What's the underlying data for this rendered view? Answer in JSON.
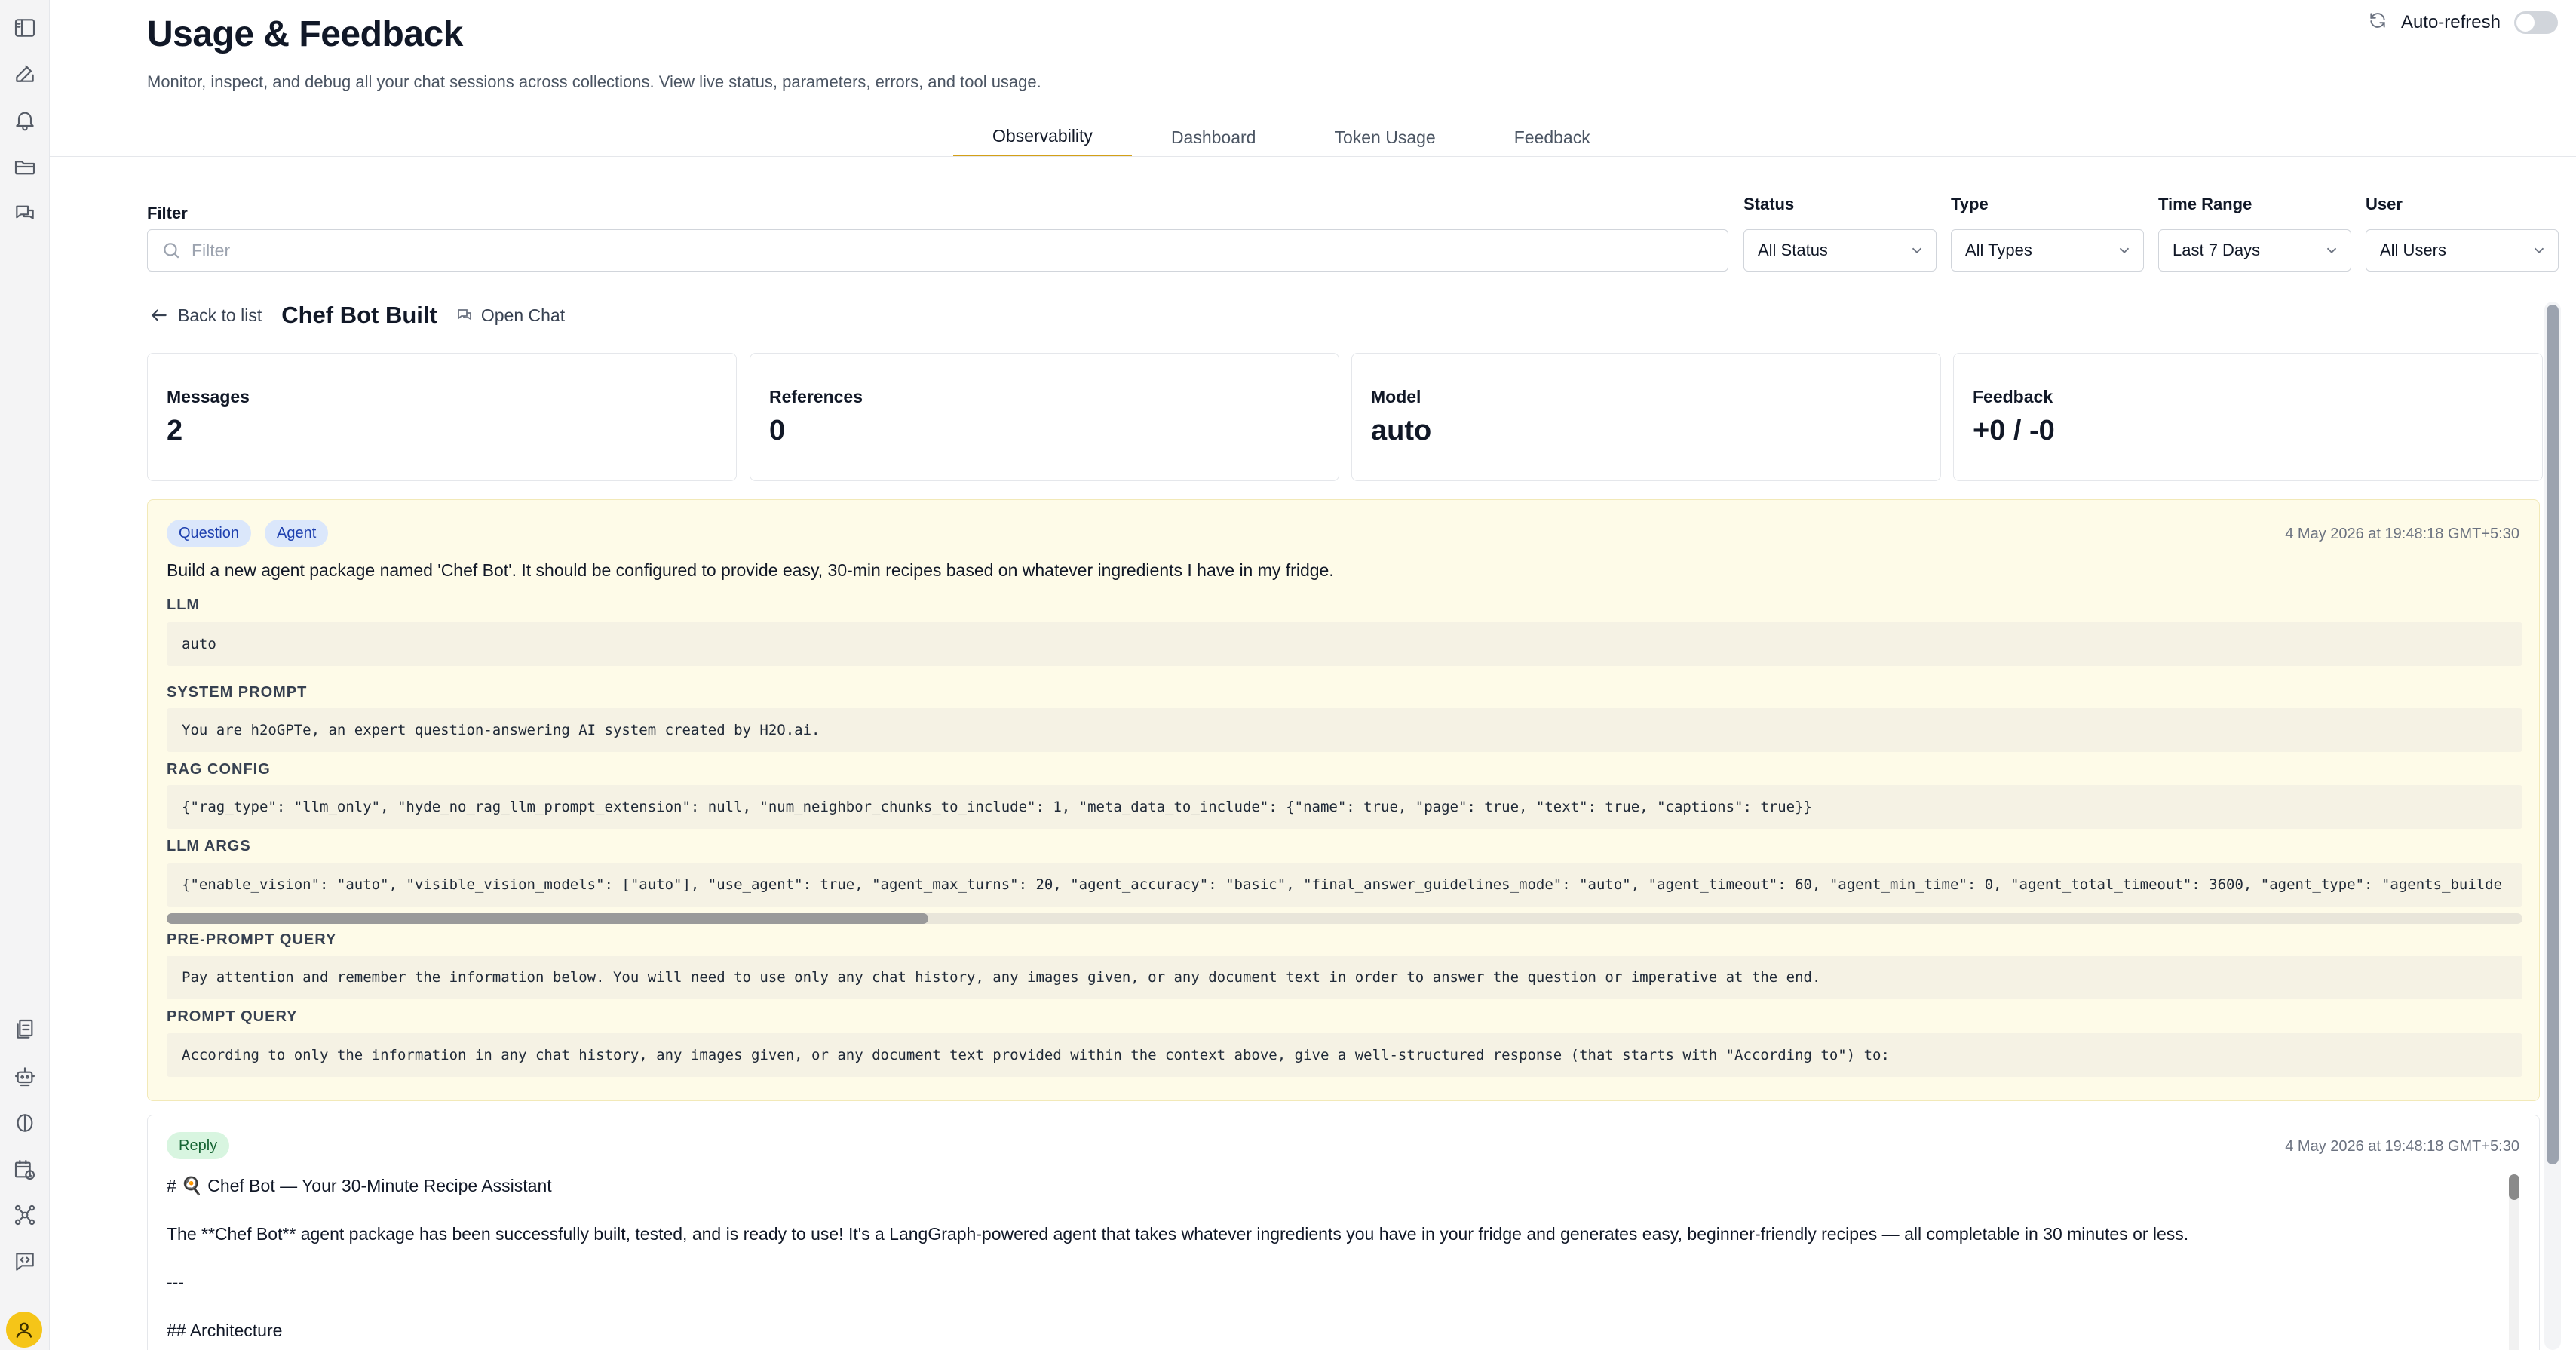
{
  "header": {
    "title": "Usage & Feedback",
    "subtitle": "Monitor, inspect, and debug all your chat sessions across collections. View live status, parameters, errors, and tool usage.",
    "auto_refresh_label": "Auto-refresh",
    "auto_refresh_on": false
  },
  "tabs": [
    {
      "label": "Observability",
      "active": true
    },
    {
      "label": "Dashboard",
      "active": false
    },
    {
      "label": "Token Usage",
      "active": false
    },
    {
      "label": "Feedback",
      "active": false
    }
  ],
  "filters": {
    "filter_label": "Filter",
    "filter_placeholder": "Filter",
    "status": {
      "label": "Status",
      "value": "All Status"
    },
    "type": {
      "label": "Type",
      "value": "All Types"
    },
    "time_range": {
      "label": "Time Range",
      "value": "Last 7 Days"
    },
    "user": {
      "label": "User",
      "value": "All Users"
    }
  },
  "detail": {
    "back_label": "Back to list",
    "chat_name": "Chef Bot Built",
    "open_chat_label": "Open Chat"
  },
  "stats": [
    {
      "label": "Messages",
      "value": "2"
    },
    {
      "label": "References",
      "value": "0"
    },
    {
      "label": "Model",
      "value": "auto"
    },
    {
      "label": "Feedback",
      "value": "+0 / -0"
    }
  ],
  "question": {
    "badges": [
      "Question",
      "Agent"
    ],
    "timestamp": "4 May 2026 at 19:48:18 GMT+5:30",
    "text": "Build a new agent package named 'Chef Bot'. It should be configured to provide easy, 30-min recipes based on whatever ingredients I have in my fridge.",
    "sections": [
      {
        "label": "LLM",
        "value": "auto"
      },
      {
        "label": "SYSTEM PROMPT",
        "value": "You are h2oGPTe, an expert question-answering AI system created by H2O.ai."
      },
      {
        "label": "RAG CONFIG",
        "value": "{\"rag_type\": \"llm_only\", \"hyde_no_rag_llm_prompt_extension\": null, \"num_neighbor_chunks_to_include\": 1, \"meta_data_to_include\": {\"name\": true, \"page\": true, \"text\": true, \"captions\": true}}"
      },
      {
        "label": "LLM ARGS",
        "value": "{\"enable_vision\": \"auto\", \"visible_vision_models\": [\"auto\"], \"use_agent\": true, \"agent_max_turns\": 20, \"agent_accuracy\": \"basic\", \"final_answer_guidelines_mode\": \"auto\", \"agent_timeout\": 60, \"agent_min_time\": 0, \"agent_total_timeout\": 3600, \"agent_type\": \"agents_builde"
      },
      {
        "label": "PRE-PROMPT QUERY",
        "value": "Pay attention and remember the information below. You will need to use only any chat history, any images given, or any document text in order to answer the question or imperative at the end."
      },
      {
        "label": "PROMPT QUERY",
        "value": "According to only the information in any chat history, any images given, or any document text provided within the context above, give a well-structured response (that starts with \"According to\") to:"
      }
    ]
  },
  "reply": {
    "badge": "Reply",
    "timestamp": "4 May 2026 at 19:48:18 GMT+5:30",
    "lines": [
      "# 🍳 Chef Bot — Your 30-Minute Recipe Assistant",
      "The **Chef Bot** agent package has been successfully built, tested, and is ready to use! It's a LangGraph-powered agent that takes whatever ingredients you have in your fridge and generates easy, beginner-friendly recipes — all completable in 30 minutes or less.",
      "---",
      "## Architecture"
    ]
  },
  "icons": {
    "rail_top": [
      "sidebar-toggle-icon",
      "edit-icon",
      "bell-icon",
      "folder-icon",
      "chat-icon"
    ],
    "rail_bottom": [
      "documents-icon",
      "robot-icon",
      "brain-icon",
      "calendar-clock-icon",
      "network-icon",
      "code-message-icon"
    ]
  },
  "colors": {
    "tab_active": "#d4a017",
    "question_bg": "#fefbe8",
    "badge_blue": "#dbe7fb",
    "badge_green": "#d8f5e0",
    "avatar": "#f5c518"
  }
}
